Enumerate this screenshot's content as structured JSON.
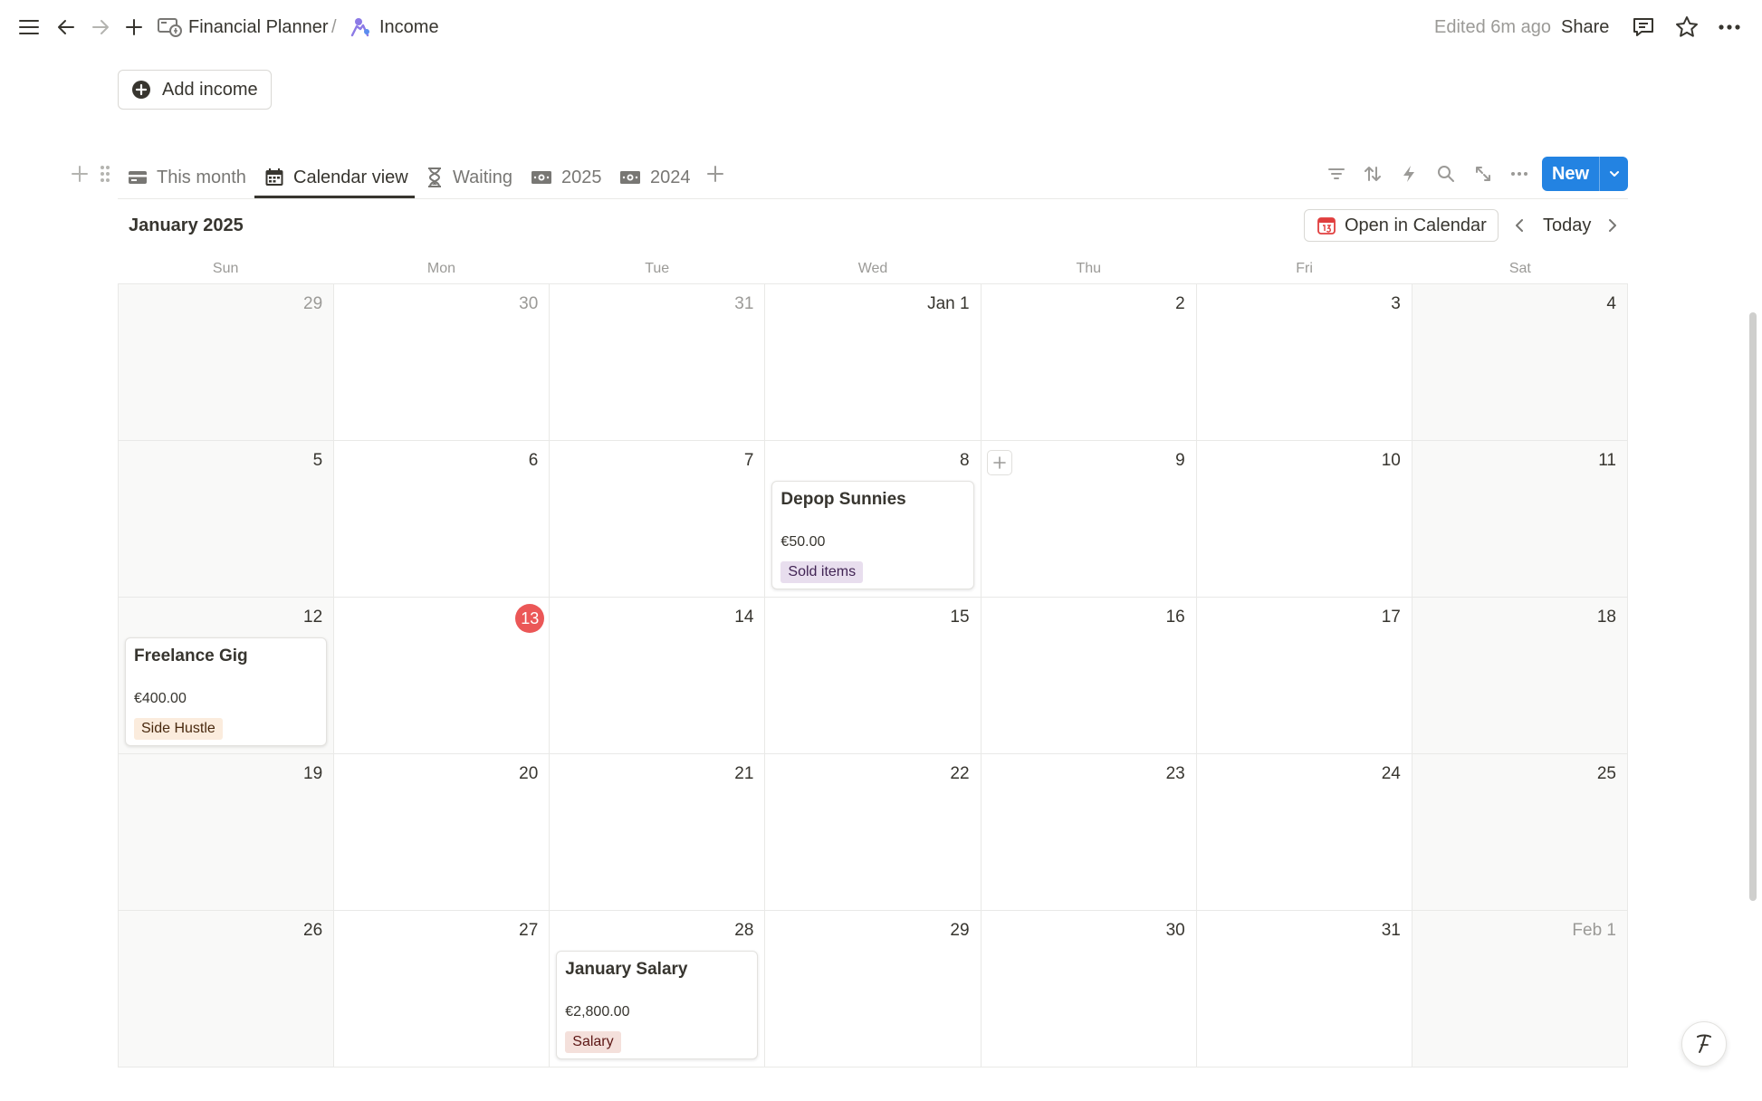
{
  "breadcrumb": {
    "parent": "Financial Planner",
    "separator": "/",
    "current": "Income"
  },
  "topbar": {
    "edited": "Edited 6m ago",
    "share": "Share"
  },
  "add_income": {
    "label": "Add income"
  },
  "tabs": [
    {
      "label": "This month",
      "icon": "card-icon",
      "active": false
    },
    {
      "label": "Calendar view",
      "icon": "calendar-icon",
      "active": true
    },
    {
      "label": "Waiting",
      "icon": "hourglass-icon",
      "active": false
    },
    {
      "label": "2025",
      "icon": "banknote-icon",
      "active": false
    },
    {
      "label": "2024",
      "icon": "banknote-icon",
      "active": false
    }
  ],
  "toolbar": {
    "new_label": "New"
  },
  "calendar": {
    "month": "January 2025",
    "open_in_calendar": "Open in Calendar",
    "today_label": "Today",
    "weekdays": [
      "Sun",
      "Mon",
      "Tue",
      "Wed",
      "Thu",
      "Fri",
      "Sat"
    ],
    "weeks": [
      [
        {
          "label": "29",
          "muted": true
        },
        {
          "label": "30",
          "muted": true
        },
        {
          "label": "31",
          "muted": true
        },
        {
          "label": "Jan 1"
        },
        {
          "label": "2"
        },
        {
          "label": "3"
        },
        {
          "label": "4"
        }
      ],
      [
        {
          "label": "5"
        },
        {
          "label": "6"
        },
        {
          "label": "7"
        },
        {
          "label": "8"
        },
        {
          "label": "9"
        },
        {
          "label": "10"
        },
        {
          "label": "11"
        }
      ],
      [
        {
          "label": "12"
        },
        {
          "label": "13",
          "today": true
        },
        {
          "label": "14"
        },
        {
          "label": "15"
        },
        {
          "label": "16"
        },
        {
          "label": "17"
        },
        {
          "label": "18"
        }
      ],
      [
        {
          "label": "19"
        },
        {
          "label": "20"
        },
        {
          "label": "21"
        },
        {
          "label": "22"
        },
        {
          "label": "23"
        },
        {
          "label": "24"
        },
        {
          "label": "25"
        }
      ],
      [
        {
          "label": "26"
        },
        {
          "label": "27"
        },
        {
          "label": "28"
        },
        {
          "label": "29"
        },
        {
          "label": "30"
        },
        {
          "label": "31"
        },
        {
          "label": "Feb 1",
          "muted": true
        }
      ]
    ],
    "events": [
      {
        "title": "Depop Sunnies",
        "amount": "€50.00",
        "tag": "Sold items",
        "tag_bg": "#e8deee",
        "tag_color": "#412454"
      },
      {
        "title": "Freelance Gig",
        "amount": "€400.00",
        "tag": "Side Hustle",
        "tag_bg": "#fbecdd",
        "tag_color": "#49290e"
      },
      {
        "title": "January Salary",
        "amount": "€2,800.00",
        "tag": "Salary",
        "tag_bg": "#f4e0db",
        "tag_color": "#5d1715"
      }
    ]
  },
  "colors": {
    "accent": "#2383e2",
    "today_badge": "#eb5757"
  }
}
